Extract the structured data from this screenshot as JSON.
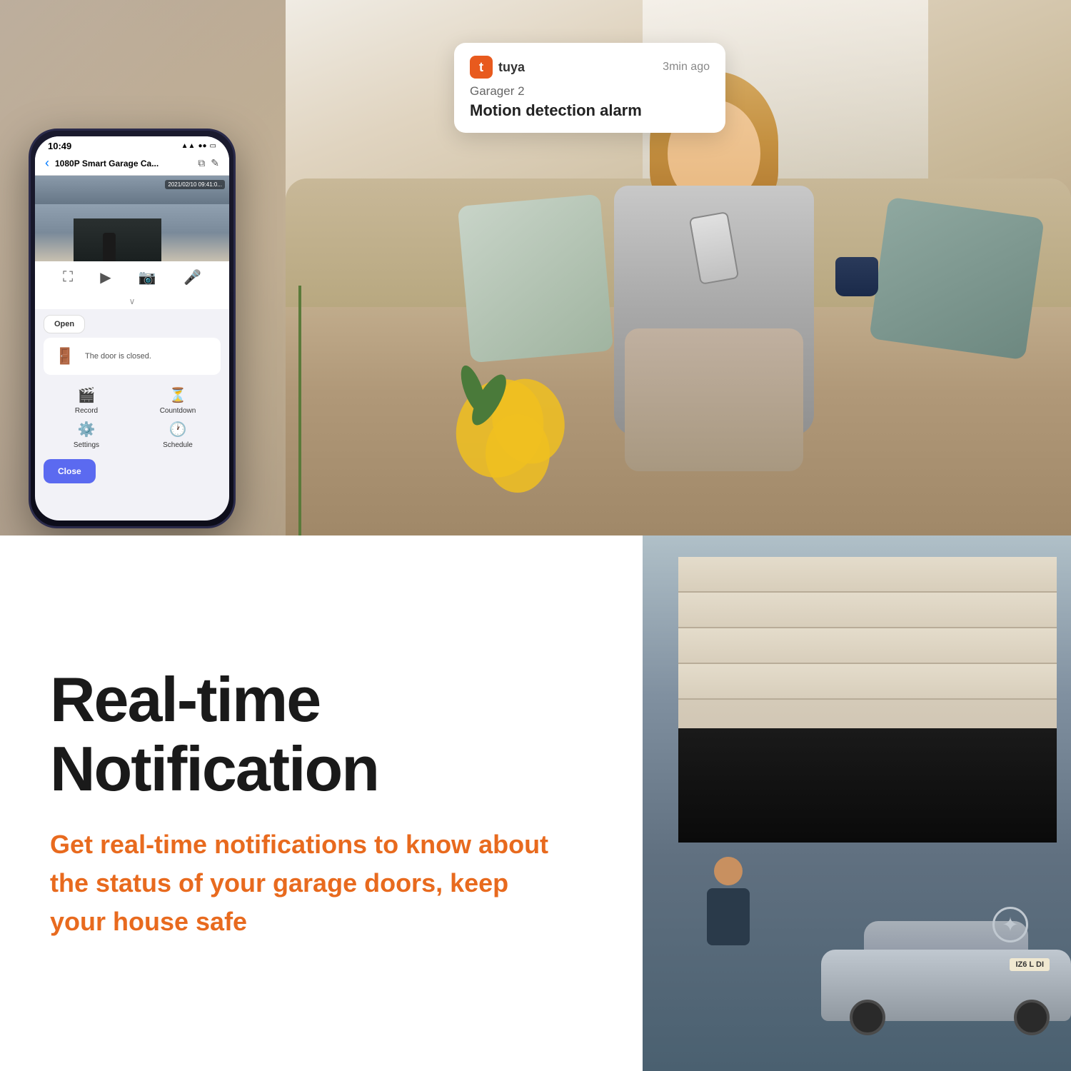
{
  "notification": {
    "app_name": "tuya",
    "time_ago": "3min ago",
    "device": "Garager 2",
    "message": "Motion detection alarm"
  },
  "phone": {
    "status_time": "10:49",
    "nav_title": "1080P Smart Garage Ca...",
    "camera_timestamp": "2021/02/10 09:41:0...",
    "door_status": "The door is closed.",
    "open_button": "Open",
    "close_button": "Close",
    "record_label": "Record",
    "countdown_label": "Countdown",
    "settings_label": "Settings",
    "schedule_label": "Schedule"
  },
  "bottom": {
    "heading": "Real-time Notification",
    "subtext": "Get real-time notifications to know about the status of your garage doors, keep your house safe"
  },
  "license_plate": "IZ6 L DI"
}
